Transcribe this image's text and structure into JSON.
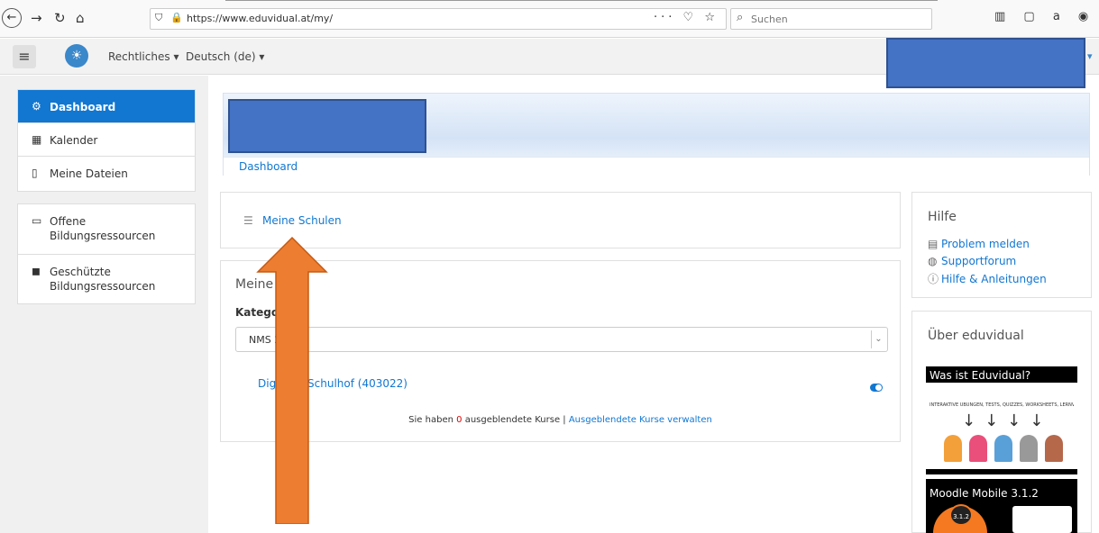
{
  "browser": {
    "back": "←",
    "forward": "→",
    "reload": "↻",
    "home": "⌂",
    "url": "https://www.eduvidual.at/my/",
    "url_actions": "··· ♡ ☆",
    "search_placeholder": "Suchen",
    "right_icons": "▥ ▢ a ◉"
  },
  "moodlebar": {
    "menu_rechtliches": "Rechtliches",
    "menu_language": "Deutsch (de)"
  },
  "sidebar": {
    "items": [
      {
        "label": "Dashboard",
        "icon": "dashboard-icon"
      },
      {
        "label": "Kalender",
        "icon": "calendar-icon"
      },
      {
        "label": "Meine Dateien",
        "icon": "file-icon"
      }
    ],
    "items2": [
      {
        "label": "Offene\nBildungsressourcen",
        "icon": "monitor-icon"
      },
      {
        "label": "Geschützte\nBildungsressourcen",
        "icon": "book-icon"
      }
    ]
  },
  "header": {
    "breadcrumb": "Dashboard"
  },
  "main": {
    "meine_schulen": "Meine Schulen",
    "meine_kurse_title": "Meine K",
    "kategorie_label": "Kategori",
    "select_value": "NMS 2",
    "course_link": "Digitaler Schulhof (403022)",
    "hidden_prefix": "Sie haben",
    "hidden_count": "0",
    "hidden_mid": "ausgeblendete Kurse |",
    "hidden_link": "Ausgeblendete Kurse verwalten"
  },
  "help": {
    "title": "Hilfe",
    "items": [
      "Problem melden",
      "Supportforum",
      "Hilfe & Anleitungen"
    ]
  },
  "about": {
    "title": "Über eduvidual",
    "video1_title": "Was ist Eduvidual?",
    "video1_sub": "INTERAKTIVE ÜBUNGEN, TESTS, QUIZZES, WORKSHEETS, LERNVIDEOS...",
    "video2_title": "Moodle Mobile 3.1.2",
    "video2_badge": "3.1.2"
  },
  "colors": {
    "accent": "#1177d1",
    "redaction": "#4472c4",
    "arrow": "#ed7d31"
  }
}
